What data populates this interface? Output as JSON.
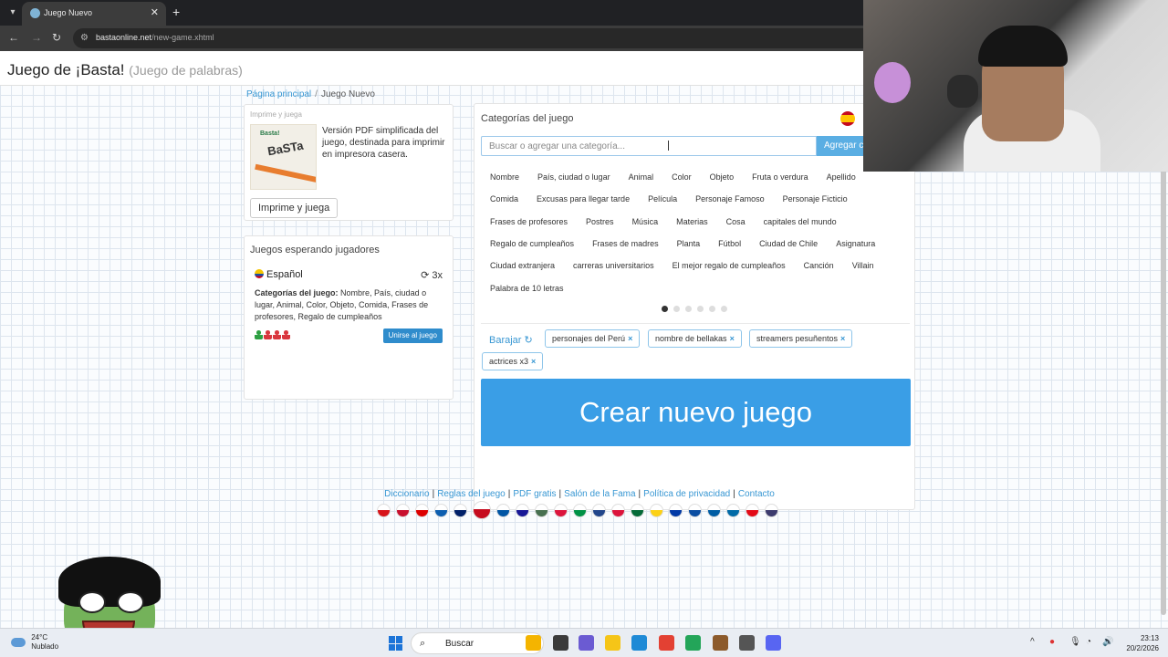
{
  "browser": {
    "tab_title": "Juego Nuevo",
    "tab_close": "✕",
    "new_tab": "+",
    "back": "←",
    "forward": "→",
    "reload": "↻",
    "url_host": "bastaonline.net",
    "url_path": "/new-game.xhtml"
  },
  "header": {
    "title": "Juego de ¡Basta!",
    "subtitle": "(Juego de palabras)"
  },
  "breadcrumb": {
    "home": "Página principal",
    "separator": "/",
    "current": "Juego Nuevo"
  },
  "print_card": {
    "heading": "Imprime y juega",
    "thumb_logo": "Basta!",
    "thumb_text": "BaSTa",
    "description": "Versión PDF simplificada del juego, destinada para imprimir en impresora casera.",
    "button": "Imprime y juega"
  },
  "waiting_card": {
    "title": "Juegos esperando jugadores",
    "language": "Español",
    "rounds": "3x",
    "categories_label": "Categorías del juego:",
    "categories_value": " Nombre, País, ciudad o lugar, Animal, Color, Objeto, Comida, Frases de profesores, Regalo de cumpleaños",
    "join_button": "Unirse al juego",
    "player_colors": [
      "#2ea043",
      "#d9363e",
      "#d9363e",
      "#d9363e"
    ]
  },
  "categories_card": {
    "title": "Categorías del juego",
    "search_placeholder": "Buscar o agregar una categoría...",
    "add_button": "Agregar c",
    "rows": [
      [
        "Nombre",
        "País, ciudad o lugar",
        "Animal",
        "Color",
        "Objeto",
        "Fruta o verdura",
        "Apellido"
      ],
      [
        "Comida",
        "Excusas para llegar tarde",
        "Película",
        "Personaje Famoso",
        "Personaje Ficticio"
      ],
      [
        "Frases de profesores",
        "Postres",
        "Música",
        "Materias",
        "Cosa",
        "capitales del mundo"
      ],
      [
        "Regalo de cumpleaños",
        "Frases de madres",
        "Planta",
        "Fútbol",
        "Ciudad de Chile",
        "Asignatura"
      ],
      [
        "Ciudad extranjera",
        "carreras universitarios",
        "El mejor regalo de cumpleaños",
        "Canción",
        "Villain"
      ],
      [
        "Palabra de 10 letras"
      ]
    ],
    "pager_total": 6,
    "pager_active": 1,
    "shuffle_label": "Barajar",
    "shuffle_icon": "↻",
    "selected_tags": [
      "personajes del Perú",
      "nombre de bellakas",
      "streamers pesuñentos",
      "actrices x3"
    ],
    "remove_icon": "×",
    "create_button": "Crear nuevo juego"
  },
  "footer": {
    "links": [
      "Diccionario",
      "Reglas del juego",
      "PDF gratis",
      "Salón de la Fama",
      "Política de privacidad",
      "Contacto"
    ],
    "separator": "|",
    "language_flags": [
      "#d7141a",
      "#c8102e",
      "#dd0000",
      "#0d5eaf",
      "#012169",
      "#c60b1e",
      "#0055a4",
      "#171796",
      "#477050",
      "#dc143c",
      "#009246",
      "#21468b",
      "#dc143c",
      "#046a38",
      "#fcd116",
      "#0039a6",
      "#0b4ea2",
      "#005da4",
      "#006aa7",
      "#e30a17",
      "#3c3b6e"
    ]
  },
  "taskbar": {
    "temperature": "24°C",
    "weather": "Nublado",
    "search": "Buscar",
    "search_icon": "⌕",
    "time": "23:13",
    "date": "20/2/2026",
    "tray_up_icon": "^",
    "app_colors": [
      "#f4b400",
      "#3a3a3a",
      "#6b5bd2",
      "#f5c518",
      "#1e8ad6",
      "#e34133",
      "#23a559",
      "#8c5a2b",
      "#555555",
      "#5865f2"
    ]
  }
}
